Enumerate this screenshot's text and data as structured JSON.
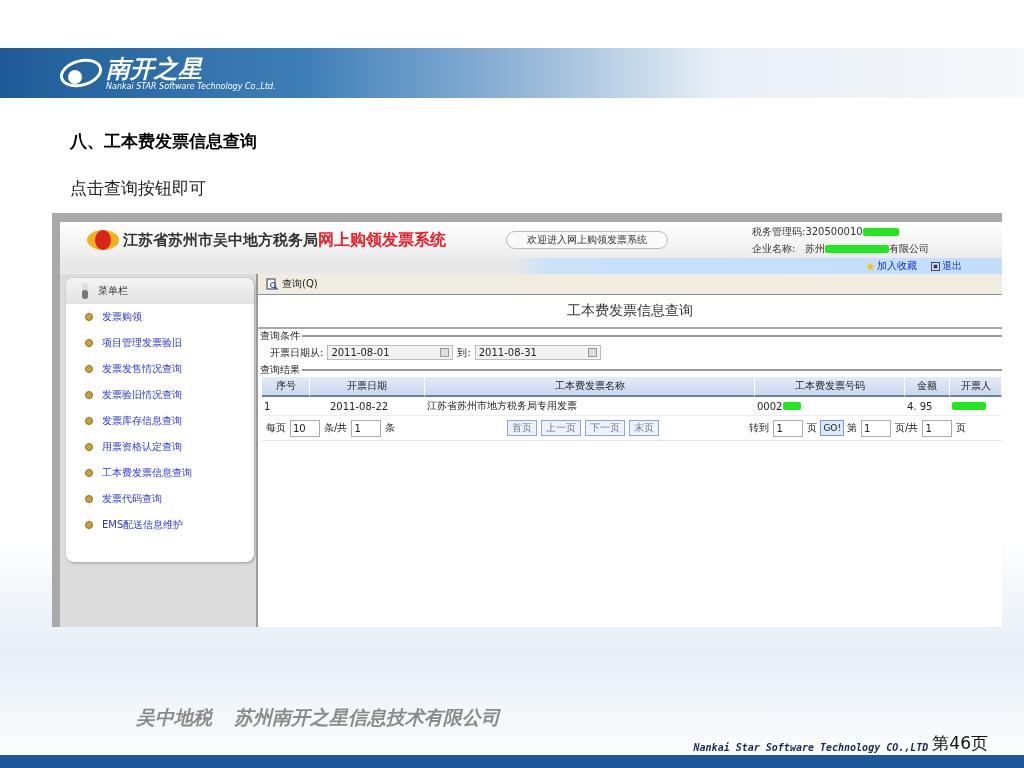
{
  "slide": {
    "logo": {
      "name": "南开之星",
      "tagline": "Nankai STAR Software Technology Co.,Ltd."
    },
    "heading": "八、工本费发票信息查询",
    "instruction": "点击查询按钮即可"
  },
  "app": {
    "agency": "江苏省苏州市吴中地方税务局",
    "system_name": "网上购领发票系统",
    "welcome": "欢迎进入网上购领发票系统",
    "tax_code_label": "税务管理码:",
    "tax_code": "320500010",
    "company_label": "企业名称:",
    "company_prefix": "苏州",
    "company_suffix": "有限公司",
    "links": [
      "加入收藏",
      "退出"
    ]
  },
  "sidebar": {
    "title": "菜单栏",
    "items": [
      "发票购领",
      "项目管理发票验旧",
      "发票发售情况查询",
      "发票验旧情况查询",
      "发票库存信息查询",
      "用票资格认定查询",
      "工本费发票信息查询",
      "发票代码查询",
      "EMS配送信息维护"
    ]
  },
  "toolbar": {
    "query_button": "查询(Q)"
  },
  "page_title": "工本费发票信息查询",
  "conditions": {
    "legend": "查询条件",
    "from_label": "开票日期从:",
    "from": "2011-08-01",
    "to_label": "到:",
    "to": "2011-08-31"
  },
  "results": {
    "legend": "查询结果",
    "columns": [
      "序号",
      "开票日期",
      "工本费发票名称",
      "工本费发票号码",
      "金额",
      "开票人"
    ],
    "rows": [
      {
        "index": "1",
        "date": "2011-08-22",
        "name": "江苏省苏州市地方税务局专用发票",
        "number": "0002",
        "amount": "4. 95"
      }
    ]
  },
  "pager": {
    "per_page_label": "每页",
    "per_page": "10",
    "total_label": "条/共",
    "total": "1",
    "unit": "条",
    "buttons": [
      {
        "label": "首页",
        "disabled": true
      },
      {
        "label": "上一页",
        "disabled": true
      },
      {
        "label": "下一页",
        "disabled": true
      },
      {
        "label": "末页",
        "disabled": true
      }
    ],
    "goto_label": "转到",
    "goto": "1",
    "goto_unit": "页",
    "go": "GO!",
    "current_label": "第",
    "current": "1",
    "pages_label": "页/共",
    "pages": "1",
    "pages_unit": "页"
  },
  "footer": {
    "agency": "吴中地税",
    "company": "苏州南开之星信息技术有限公司",
    "english": "Nankai Star Software Technology CO.,LTD",
    "page": "第46页"
  }
}
